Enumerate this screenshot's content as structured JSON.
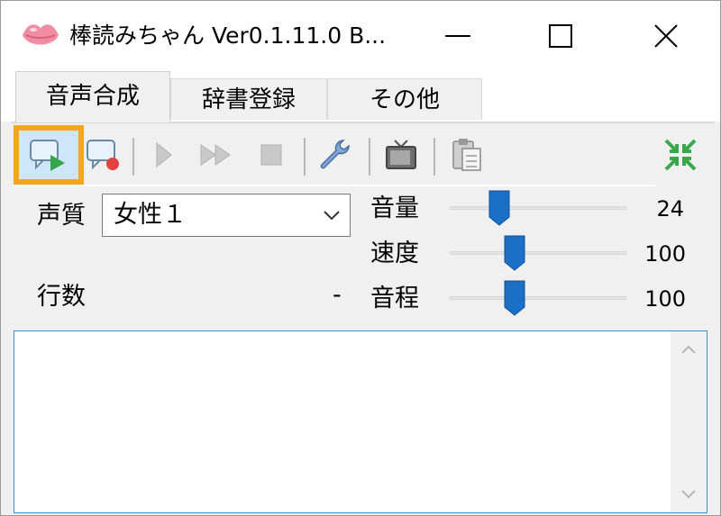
{
  "window": {
    "title": "棒読みちゃん Ver0.1.11.0 B..."
  },
  "tabs": [
    {
      "label": "音声合成",
      "active": true
    },
    {
      "label": "辞書登録",
      "active": false
    },
    {
      "label": "その他",
      "active": false
    }
  ],
  "toolbar": {
    "buttons": [
      {
        "icon": "speak-play-icon",
        "highlighted": true
      },
      {
        "icon": "speak-record-icon"
      },
      {
        "icon": "play-icon"
      },
      {
        "icon": "fast-forward-icon"
      },
      {
        "icon": "stop-icon"
      },
      {
        "icon": "wrench-icon"
      },
      {
        "icon": "tv-icon"
      },
      {
        "icon": "clipboard-icon"
      },
      {
        "icon": "collapse-icon"
      }
    ]
  },
  "voice": {
    "label": "声質",
    "selected": "女性１"
  },
  "line_count": {
    "label": "行数",
    "value": "-"
  },
  "sliders": [
    {
      "label": "音量",
      "value": "24",
      "level": 0.25
    },
    {
      "label": "速度",
      "value": "100",
      "level": 0.35
    },
    {
      "label": "音程",
      "value": "100",
      "level": 0.35
    }
  ],
  "colors": {
    "highlight": "#f4a621",
    "thumb": "#1c6fc7",
    "collapse_icon": "#3aa84a"
  }
}
